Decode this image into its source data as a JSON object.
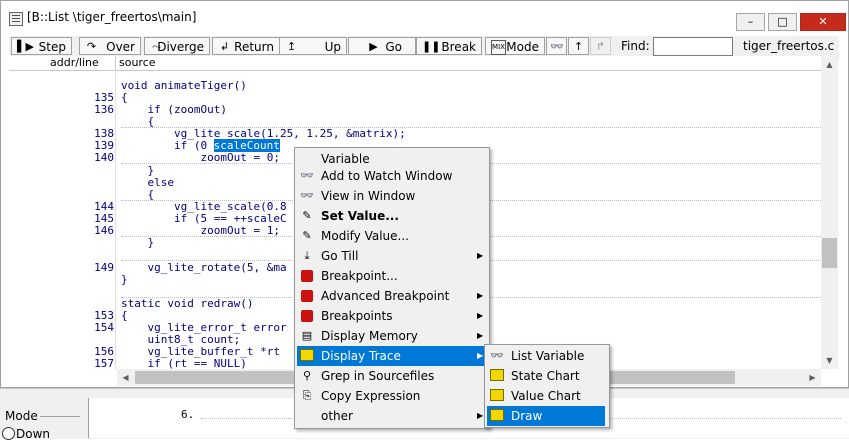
{
  "window": {
    "title": "[B::List \\tiger_freertos\\main]",
    "controls": [
      "–",
      "□",
      "✕"
    ]
  },
  "toolbar": {
    "step": "Step",
    "over": "Over",
    "diverge": "Diverge",
    "return": "Return",
    "up": "Up",
    "go": "Go",
    "break": "Break",
    "mode": "Mode",
    "find_label": "Find:",
    "find_value": "",
    "file": "tiger_freertos.c"
  },
  "columns": {
    "addr": "addr/line",
    "source": "source"
  },
  "source_lines": [
    {
      "ln": "",
      "code": "void animateTiger()"
    },
    {
      "ln": "135",
      "code": "{"
    },
    {
      "ln": "136",
      "code": "    if (zoomOut)"
    },
    {
      "ln": "",
      "code": "    {"
    },
    {
      "ln": "138",
      "code": "        vg_lite_scale(1.25, 1.25, &matrix);"
    },
    {
      "ln": "139",
      "code": "        if (0 == --"
    },
    {
      "ln": "140",
      "code": "            zoomOut = 0;"
    },
    {
      "ln": "",
      "code": "    }"
    },
    {
      "ln": "",
      "code": "    else"
    },
    {
      "ln": "",
      "code": "    {"
    },
    {
      "ln": "144",
      "code": "        vg_lite_scale(0.8"
    },
    {
      "ln": "145",
      "code": "        if (5 == ++scaleC"
    },
    {
      "ln": "146",
      "code": "            zoomOut = 1;"
    },
    {
      "ln": "",
      "code": "    }"
    },
    {
      "ln": "",
      "code": ""
    },
    {
      "ln": "149",
      "code": "    vg_lite_rotate(5, &ma"
    },
    {
      "ln": "",
      "code": "}"
    },
    {
      "ln": "",
      "code": ""
    },
    {
      "ln": "",
      "code": "static void redraw()"
    },
    {
      "ln": "153",
      "code": "{"
    },
    {
      "ln": "154",
      "code": "    vg_lite_error_t error"
    },
    {
      "ln": "",
      "code": "    uint8_t count;"
    },
    {
      "ln": "156",
      "code": "    vg_lite_buffer_t *rt"
    },
    {
      "ln": "157",
      "code": "    if (rt == NULL)"
    }
  ],
  "selected_token": "scaleCount",
  "bottom": {
    "mode_label": "Mode",
    "down_label": "Down",
    "line_number": "6."
  },
  "context_menu": {
    "header": "Variable",
    "items": [
      {
        "label": "Add to Watch Window",
        "icon": "glasses-icon",
        "submenu": false
      },
      {
        "label": "View in Window",
        "icon": "glasses-window-icon",
        "submenu": false
      },
      {
        "label": "Set Value...",
        "icon": "set-value-icon",
        "submenu": false,
        "bold": true
      },
      {
        "label": "Modify Value...",
        "icon": "modify-value-icon",
        "submenu": false
      },
      {
        "label": "Go Till",
        "icon": "go-till-icon",
        "submenu": true
      },
      {
        "label": "Breakpoint...",
        "icon": "breakpoint-icon",
        "submenu": false
      },
      {
        "label": "Advanced Breakpoint",
        "icon": "advanced-breakpoint-icon",
        "submenu": true
      },
      {
        "label": "Breakpoints",
        "icon": "breakpoints-icon",
        "submenu": true
      },
      {
        "label": "Display Memory",
        "icon": "memory-icon",
        "submenu": true
      },
      {
        "label": "Display Trace",
        "icon": "trace-icon",
        "submenu": true,
        "selected": true
      },
      {
        "label": "Grep in Sourcefiles",
        "icon": "grep-icon",
        "submenu": false
      },
      {
        "label": "Copy Expression",
        "icon": "copy-icon",
        "submenu": false
      },
      {
        "label": "other",
        "icon": "",
        "submenu": true
      }
    ]
  },
  "submenu": {
    "items": [
      {
        "label": "List Variable",
        "icon": "list-variable-icon"
      },
      {
        "label": "State Chart",
        "icon": "state-chart-icon"
      },
      {
        "label": "Value Chart",
        "icon": "value-chart-icon"
      },
      {
        "label": "Draw",
        "icon": "draw-icon",
        "selected": true
      }
    ]
  },
  "colors": {
    "selection": "#0078d7",
    "code": "#000080",
    "close": "#c42b1c"
  }
}
